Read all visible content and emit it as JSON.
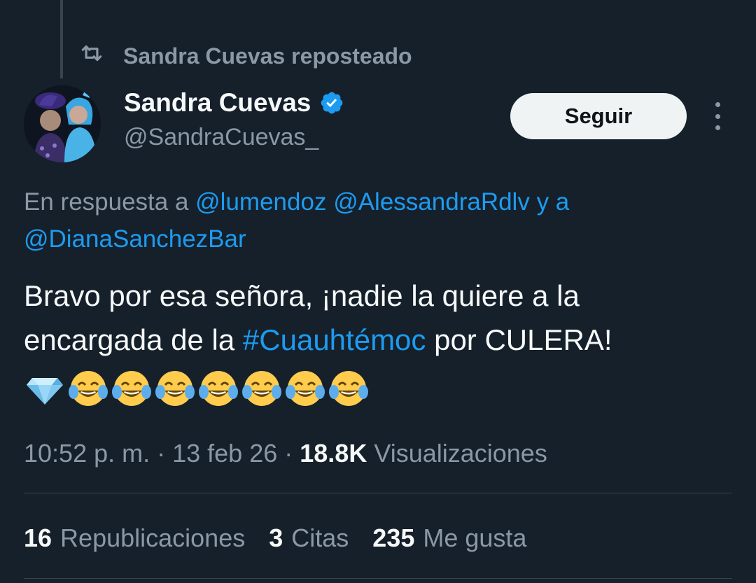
{
  "repost": {
    "label": "Sandra Cuevas reposteado",
    "icon": "repost-icon"
  },
  "author": {
    "name": "Sandra Cuevas",
    "handle": "@SandraCuevas_",
    "verified": true,
    "verified_color": "#1d9bf0"
  },
  "follow": {
    "label": "Seguir"
  },
  "reply_to": {
    "prefix": "En respuesta a ",
    "user1": "@lumendoz",
    "user2": "@AlessandraRdlv",
    "and": "y a",
    "user3": "@DianaSanchezBar"
  },
  "tweet": {
    "line1": "Bravo por esa señora, ¡nadie la quiere a la",
    "line2_prefix": "encargada de la ",
    "hashtag": "#Cuauhtémoc",
    "line2_suffix": " por CULERA!",
    "emojis": [
      "gem-emoji",
      "joy-emoji",
      "joy-emoji",
      "joy-emoji",
      "joy-emoji",
      "joy-emoji",
      "joy-emoji",
      "joy-emoji"
    ]
  },
  "meta": {
    "time": "10:52 p. m.",
    "separator": " · ",
    "date": "13 feb 26",
    "views_count": "18.8K",
    "views_label": "Visualizaciones"
  },
  "stats": {
    "reposts_count": "16",
    "reposts_label": "Republicaciones",
    "quotes_count": "3",
    "quotes_label": "Citas",
    "likes_count": "235",
    "likes_label": "Me gusta"
  },
  "colors": {
    "background": "#15202b",
    "text": "#f7f9f9",
    "secondary": "#8b98a5",
    "link": "#1d9bf0",
    "divider": "#38444d"
  }
}
